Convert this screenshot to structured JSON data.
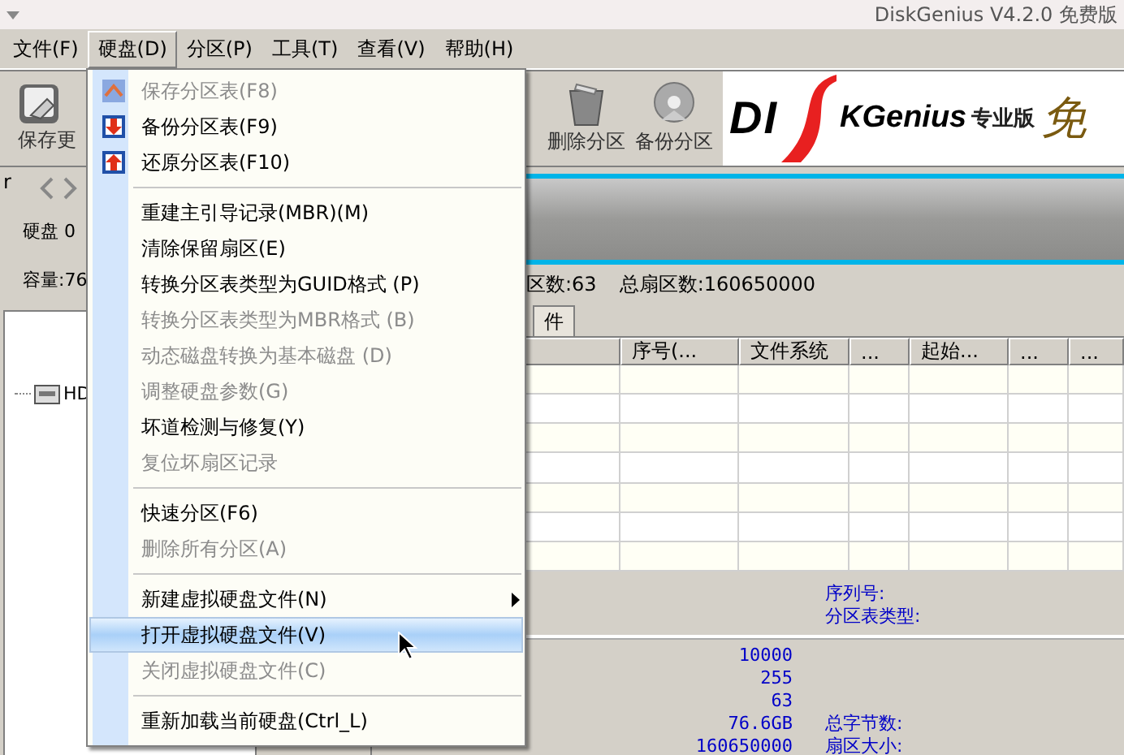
{
  "window": {
    "title": "DiskGenius V4.2.0 免费版"
  },
  "menu_bar": [
    {
      "label": "文件(F)",
      "selected": false
    },
    {
      "label": "硬盘(D)",
      "selected": true
    },
    {
      "label": "分区(P)",
      "selected": false
    },
    {
      "label": "工具(T)",
      "selected": false
    },
    {
      "label": "查看(V)",
      "selected": false
    },
    {
      "label": "帮助(H)",
      "selected": false
    }
  ],
  "toolbar": [
    {
      "label": "保存更",
      "kind": "save"
    },
    {
      "label": "删除分区",
      "kind": "delete"
    },
    {
      "label": "备份分区",
      "kind": "backup"
    }
  ],
  "banner": {
    "logo_left": "DI",
    "logo_right": "KGenius",
    "edition": "专业版",
    "free": "免"
  },
  "disk_panel": {
    "marker": "r",
    "disk": "硬盘 0",
    "capacity": "容量:76"
  },
  "tree": [
    {
      "label": "HD"
    }
  ],
  "info_line": [
    "区数:63",
    "总扇区数:160650000"
  ],
  "tabs": [
    {
      "label": "件",
      "selected": true
    }
  ],
  "table": {
    "columns": [
      "序号(...",
      "文件系统",
      "...",
      "起始...",
      "...",
      "..."
    ]
  },
  "details": {
    "header_fields": [
      "序列号:",
      "分区表类型:"
    ],
    "rows": [
      {
        "value": "10000"
      },
      {
        "value": "255"
      },
      {
        "value": "63"
      },
      {
        "value": "76.6GB",
        "label": "总字节数:"
      },
      {
        "value": "160650000",
        "label": "扇区大小:"
      }
    ]
  },
  "disk_menu": [
    {
      "kind": "item",
      "label": "保存分区表(F8)",
      "icon": true,
      "disabled": true,
      "submenu": false,
      "selected": false
    },
    {
      "kind": "item",
      "label": "备份分区表(F9)",
      "icon": true,
      "disabled": false,
      "submenu": false,
      "selected": false
    },
    {
      "kind": "item",
      "label": "还原分区表(F10)",
      "icon": true,
      "disabled": false,
      "submenu": false,
      "selected": false
    },
    {
      "kind": "separator"
    },
    {
      "kind": "item",
      "label": "重建主引导记录(MBR)(M)",
      "disabled": false,
      "submenu": false,
      "selected": false
    },
    {
      "kind": "item",
      "label": "清除保留扇区(E)",
      "disabled": false,
      "submenu": false,
      "selected": false
    },
    {
      "kind": "item",
      "label": "转换分区表类型为GUID格式 (P)",
      "disabled": false,
      "submenu": false,
      "selected": false
    },
    {
      "kind": "item",
      "label": "转换分区表类型为MBR格式 (B)",
      "disabled": true,
      "submenu": false,
      "selected": false
    },
    {
      "kind": "item",
      "label": "动态磁盘转换为基本磁盘 (D)",
      "disabled": true,
      "submenu": false,
      "selected": false
    },
    {
      "kind": "item",
      "label": "调整硬盘参数(G)",
      "disabled": true,
      "submenu": false,
      "selected": false
    },
    {
      "kind": "item",
      "label": "坏道检测与修复(Y)",
      "disabled": false,
      "submenu": false,
      "selected": false
    },
    {
      "kind": "item",
      "label": "复位坏扇区记录",
      "disabled": true,
      "submenu": false,
      "selected": false
    },
    {
      "kind": "separator"
    },
    {
      "kind": "item",
      "label": "快速分区(F6)",
      "disabled": false,
      "submenu": false,
      "selected": false
    },
    {
      "kind": "item",
      "label": "删除所有分区(A)",
      "disabled": true,
      "submenu": false,
      "selected": false
    },
    {
      "kind": "separator"
    },
    {
      "kind": "item",
      "label": "新建虚拟硬盘文件(N)",
      "disabled": false,
      "submenu": true,
      "selected": false
    },
    {
      "kind": "item",
      "label": "打开虚拟硬盘文件(V)",
      "disabled": false,
      "submenu": false,
      "selected": true
    },
    {
      "kind": "item",
      "label": "关闭虚拟硬盘文件(C)",
      "disabled": true,
      "submenu": false,
      "selected": false
    },
    {
      "kind": "separator"
    },
    {
      "kind": "item",
      "label": "重新加载当前硬盘(Ctrl_L)",
      "disabled": false,
      "submenu": false,
      "selected": false
    }
  ]
}
